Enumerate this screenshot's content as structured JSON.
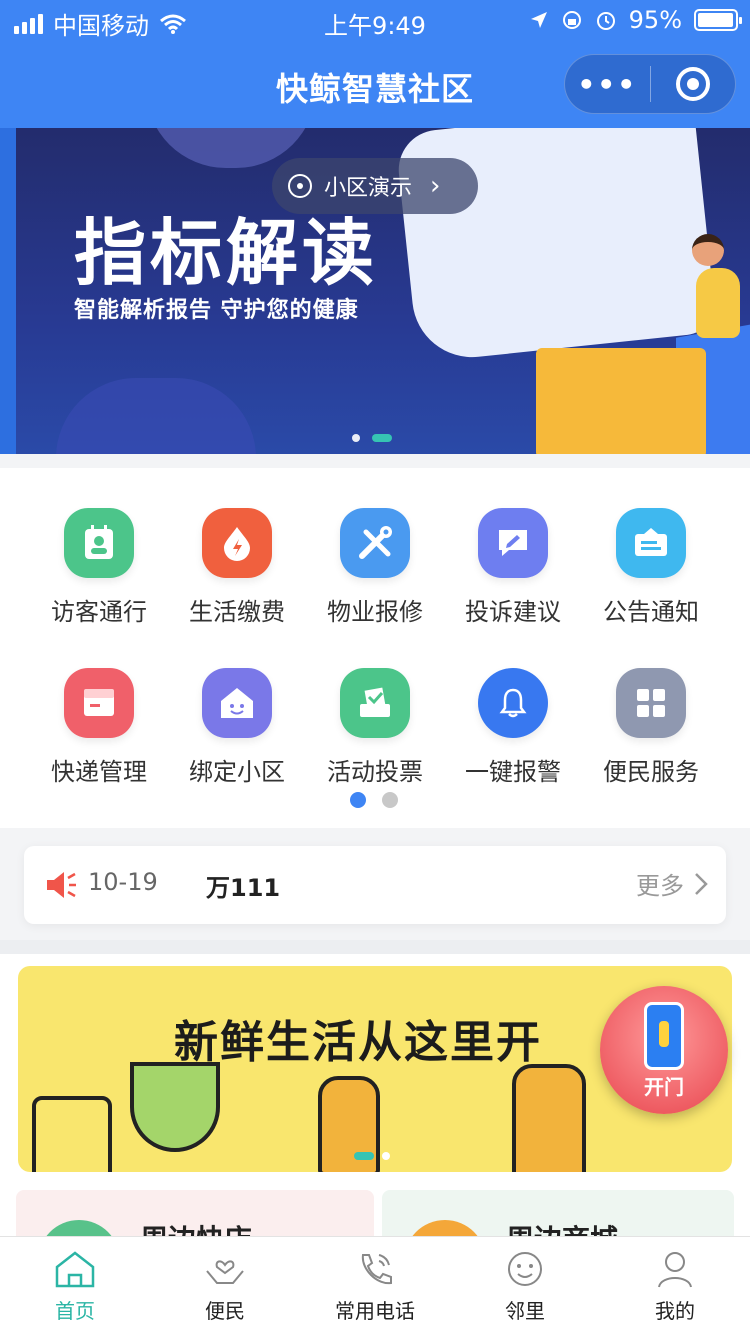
{
  "status_bar": {
    "carrier": "中国移动",
    "time": "上午9:49",
    "battery": "95%"
  },
  "nav": {
    "title": "快鲸智慧社区",
    "more_icon": "more-dots-icon",
    "close_icon": "target-circle-icon"
  },
  "hero": {
    "pill_label": "小区演示",
    "headline": "指标解读",
    "subline": "智能解析报告  守护您的健康"
  },
  "services": [
    {
      "label": "访客通行",
      "icon": "visitor-icon",
      "color": "#4cc58a"
    },
    {
      "label": "生活缴费",
      "icon": "payment-icon",
      "color": "#f0603e"
    },
    {
      "label": "物业报修",
      "icon": "repair-icon",
      "color": "#4a9af0"
    },
    {
      "label": "投诉建议",
      "icon": "complaint-icon",
      "color": "#6e7ef0"
    },
    {
      "label": "公告通知",
      "icon": "notice-icon",
      "color": "#3fb8ef"
    },
    {
      "label": "快递管理",
      "icon": "express-icon",
      "color": "#f0606a"
    },
    {
      "label": "绑定小区",
      "icon": "home-icon",
      "color": "#7a78e8"
    },
    {
      "label": "活动投票",
      "icon": "vote-icon",
      "color": "#4cc58a"
    },
    {
      "label": "一键报警",
      "icon": "bell-icon",
      "color": "#3878f0"
    },
    {
      "label": "便民服务",
      "icon": "grid-icon",
      "color": "#8f98b0"
    }
  ],
  "notice": {
    "date": "10-19",
    "text": "万111",
    "more": "更多"
  },
  "promo": {
    "slogan": "新鲜生活从这里开",
    "door_label": "开门"
  },
  "cards": {
    "left_title": "周边快店",
    "right_title": "周边商城"
  },
  "tabbar": [
    {
      "label": "首页",
      "icon": "home-tab-icon"
    },
    {
      "label": "便民",
      "icon": "care-hands-icon"
    },
    {
      "label": "常用电话",
      "icon": "phone-icon"
    },
    {
      "label": "邻里",
      "icon": "smile-icon"
    },
    {
      "label": "我的",
      "icon": "user-icon"
    }
  ],
  "colors": {
    "brand_blue": "#3e85f4",
    "tab_active": "#2bb5a5"
  }
}
